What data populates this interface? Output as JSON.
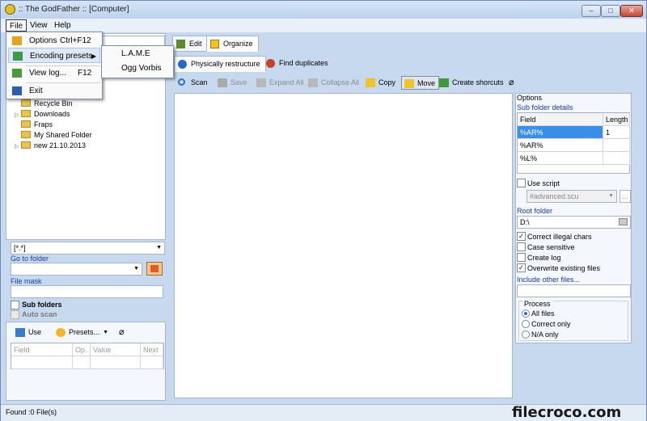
{
  "window": {
    "title": ":: The GodFather ::  [Computer]"
  },
  "window_controls": {
    "minimize": "–",
    "maximize": "□",
    "close": "✕"
  },
  "menu": {
    "file": "File",
    "view": "View",
    "help": "Help"
  },
  "file_menu": {
    "options": "Options",
    "options_shortcut": "Ctrl+F12",
    "encoding_presets": "Encoding presets",
    "view_log": "View log...",
    "view_log_shortcut": "F12",
    "exit": "Exit"
  },
  "submenu": {
    "lame": "L.A.M.E",
    "ogg": "Ogg Vorbis"
  },
  "tree": {
    "items": [
      "Recycle Bin",
      "Downloads",
      "Fraps",
      "My Shared Folder",
      "new 21.10.2013"
    ]
  },
  "left": {
    "filter_value": "[*.*]",
    "go_to_folder_label": "Go to folder",
    "file_mask_label": "File mask",
    "sub_folders": "Sub folders",
    "auto_scan": "Auto scan",
    "use_button": "Use",
    "presets_button": "Presets...",
    "grid_headers": [
      "Field",
      "Op.",
      "Value",
      "Next"
    ]
  },
  "tabs": {
    "edit": "Edit",
    "organize": "Organize",
    "physically_restructure": "Physically restructure",
    "find_duplicates": "Find duplicates"
  },
  "toolbar": {
    "scan": "Scan",
    "save": "Save",
    "expand_all": "Expand All",
    "collapse_all": "Collapse All",
    "copy": "Copy",
    "move": "Move",
    "create_shortcuts": "Create shorcuts"
  },
  "options": {
    "title": "Options",
    "sub_folder_details": "Sub folder details",
    "grid_headers": [
      "Field",
      "Length"
    ],
    "rows": [
      {
        "field": "%AR%",
        "length": "1"
      },
      {
        "field": "%AR%",
        "length": ""
      },
      {
        "field": "%L%",
        "length": ""
      }
    ],
    "use_script": "Use script",
    "script_value": "#advanced.scu",
    "ellipsis": "...",
    "root_folder_label": "Root folder",
    "root_folder_value": "D:\\",
    "correct_illegal": "Correct illegal chars",
    "case_sensitive": "Case sensitive",
    "create_log": "Create log",
    "overwrite": "Overwrite existing files",
    "include_other": "Include other files...",
    "process_title": "Process",
    "all_files": "All files",
    "correct_only": "Correct only",
    "na_only": "N/A only"
  },
  "status": {
    "found": "Found :0 File(s)"
  },
  "watermark": "filecroco.com"
}
